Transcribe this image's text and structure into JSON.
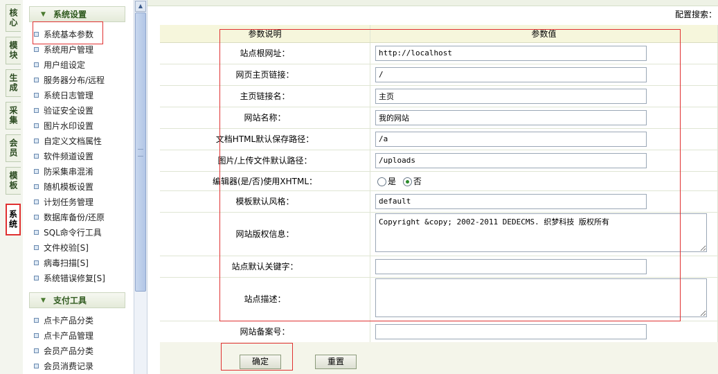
{
  "vtabs": [
    {
      "label": "核心"
    },
    {
      "label": "模块"
    },
    {
      "label": "生成"
    },
    {
      "label": "采集"
    },
    {
      "label": "会员"
    },
    {
      "label": "模板"
    },
    {
      "label": "系统",
      "active": true
    }
  ],
  "sidebar": {
    "section1": {
      "title": "系统设置",
      "items": [
        {
          "label": "系统基本参数",
          "selected": true
        },
        {
          "label": "系统用户管理"
        },
        {
          "label": "用户组设定"
        },
        {
          "label": "服务器分布/远程"
        },
        {
          "label": "系统日志管理"
        },
        {
          "label": "验证安全设置"
        },
        {
          "label": "图片水印设置"
        },
        {
          "label": "自定义文档属性"
        },
        {
          "label": "软件频道设置"
        },
        {
          "label": "防采集串混淆"
        },
        {
          "label": "随机模板设置"
        },
        {
          "label": "计划任务管理"
        },
        {
          "label": "数据库备份/还原"
        },
        {
          "label": "SQL命令行工具"
        },
        {
          "label": "文件校验[S]"
        },
        {
          "label": "病毒扫描[S]"
        },
        {
          "label": "系统错误修复[S]"
        }
      ]
    },
    "section2": {
      "title": "支付工具",
      "items": [
        {
          "label": "点卡产品分类"
        },
        {
          "label": "点卡产品管理"
        },
        {
          "label": "会员产品分类"
        },
        {
          "label": "会员消费记录"
        }
      ]
    }
  },
  "main": {
    "search_label": "配置搜索：",
    "columns": {
      "desc": "参数说明",
      "value": "参数值"
    },
    "params": {
      "basehost": {
        "label": "站点根网址：",
        "value": "http://localhost"
      },
      "indexurl": {
        "label": "网页主页链接：",
        "value": "/"
      },
      "indexname": {
        "label": "主页链接名：",
        "value": "主页"
      },
      "webname": {
        "label": "网站名称：",
        "value": "我的网站"
      },
      "arcdir": {
        "label": "文档HTML默认保存路径：",
        "value": "/a"
      },
      "medias_dir": {
        "label": "图片/上传文件默认路径：",
        "value": "/uploads"
      },
      "xhtml": {
        "label": "编辑器(是/否)使用XHTML：",
        "options": [
          "是",
          "否"
        ],
        "selected": "否"
      },
      "df_style": {
        "label": "模板默认风格：",
        "value": "default"
      },
      "powerby": {
        "label": "网站版权信息：",
        "value": "Copyright &copy; 2002-2011 DEDECMS. 织梦科技 版权所有"
      },
      "keywords": {
        "label": "站点默认关键字：",
        "value": ""
      },
      "description": {
        "label": "站点描述：",
        "value": ""
      },
      "beian": {
        "label": "网站备案号：",
        "value": ""
      }
    },
    "buttons": {
      "submit": "确定",
      "reset": "重置"
    }
  },
  "colors": {
    "highlight_box": "#e03030",
    "header_bg": "#f6f6dc",
    "sidebar_title": "#2f5a1e"
  }
}
